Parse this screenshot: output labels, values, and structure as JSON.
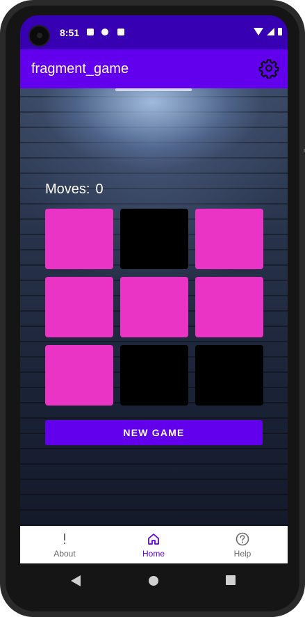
{
  "status_bar": {
    "time": "8:51",
    "notification_icons": [
      "text-icon",
      "vpn-icon",
      "sd-card-icon"
    ],
    "right_icons": [
      "wifi-icon",
      "signal-icon",
      "battery-icon"
    ]
  },
  "app_bar": {
    "title": "fragment_game",
    "settings_icon": "gear-icon"
  },
  "game": {
    "moves_label": "Moves:",
    "moves_value": "0",
    "cards": [
      {
        "state": "face-down"
      },
      {
        "state": "matched"
      },
      {
        "state": "face-down"
      },
      {
        "state": "face-down"
      },
      {
        "state": "face-down"
      },
      {
        "state": "face-down"
      },
      {
        "state": "face-down"
      },
      {
        "state": "matched"
      },
      {
        "state": "matched"
      }
    ],
    "new_game_label": "NEW GAME"
  },
  "bottom_nav": {
    "items": [
      {
        "label": "About",
        "icon": "exclamation-icon",
        "active": false
      },
      {
        "label": "Home",
        "icon": "home-icon",
        "active": true
      },
      {
        "label": "Help",
        "icon": "help-circle-icon",
        "active": false
      }
    ]
  },
  "colors": {
    "status_bar": "#3700b3",
    "primary": "#6200ee",
    "card_face_down": "#e934c6",
    "card_matched": "#000000"
  }
}
